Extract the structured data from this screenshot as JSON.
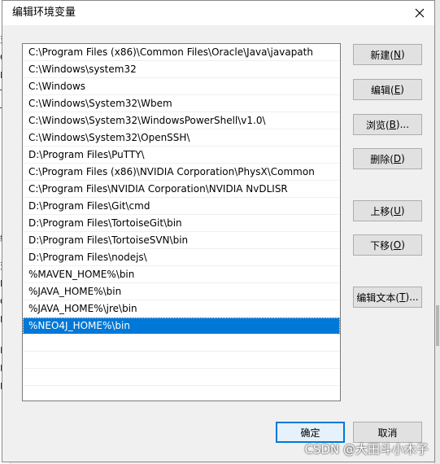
{
  "dialog": {
    "title": "编辑环境变量"
  },
  "paths": [
    "C:\\Program Files (x86)\\Common Files\\Oracle\\Java\\javapath",
    "C:\\Windows\\system32",
    "C:\\Windows",
    "C:\\Windows\\System32\\Wbem",
    "C:\\Windows\\System32\\WindowsPowerShell\\v1.0\\",
    "C:\\Windows\\System32\\OpenSSH\\",
    "D:\\Program Files\\PuTTY\\",
    "C:\\Program Files (x86)\\NVIDIA Corporation\\PhysX\\Common",
    "C:\\Program Files\\NVIDIA Corporation\\NVIDIA NvDLISR",
    "D:\\Program Files\\Git\\cmd",
    "D:\\Program Files\\TortoiseGit\\bin",
    "D:\\Program Files\\TortoiseSVN\\bin",
    "D:\\Program Files\\nodejs\\",
    "%MAVEN_HOME%\\bin",
    "%JAVA_HOME%\\bin",
    "%JAVA_HOME%\\jre\\bin",
    "%NEO4J_HOME%\\bin",
    "",
    "",
    "",
    ""
  ],
  "selected_index": 16,
  "buttons": {
    "new": {
      "text": "新建(",
      "key": "N",
      "end": ")"
    },
    "edit": {
      "text": "编辑(",
      "key": "E",
      "end": ")"
    },
    "browse": {
      "text": "浏览(",
      "key": "B",
      "end": ")..."
    },
    "delete": {
      "text": "删除(",
      "key": "D",
      "end": ")"
    },
    "up": {
      "text": "上移(",
      "key": "U",
      "end": ")"
    },
    "down": {
      "text": "下移(",
      "key": "O",
      "end": ")"
    },
    "edit_text": {
      "text": "编辑文本(",
      "key": "T",
      "end": ")..."
    },
    "ok": "确定",
    "cancel": "取消"
  },
  "background_fragments": [
    "变",
    "O",
    "Pa",
    "TE",
    "TM",
    "统",
    "变",
    "N",
    "O",
    "Pa",
    "PF",
    "PF",
    "PF"
  ],
  "watermark": "CSDN @大田斗小木子",
  "colors": {
    "selection": "#0078d7",
    "primary_border": "#0078d7"
  },
  "icons": {
    "close": "close-icon"
  }
}
